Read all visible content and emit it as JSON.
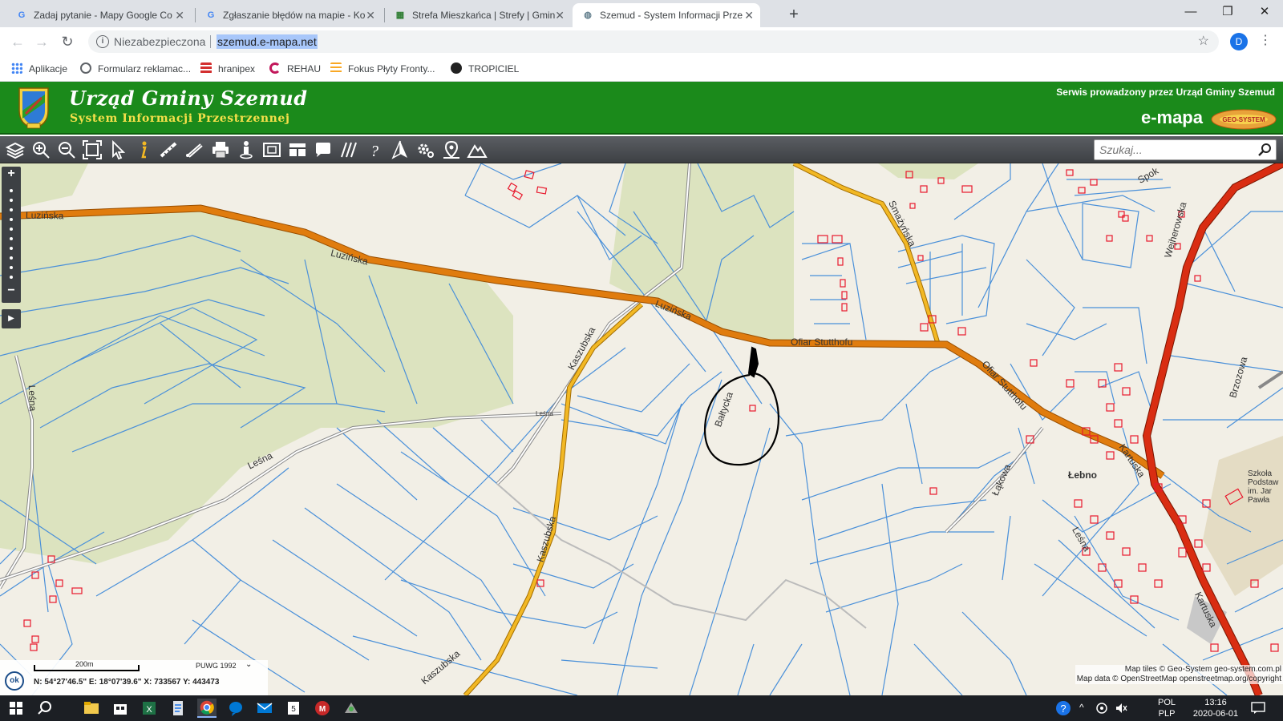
{
  "browser": {
    "tabs": [
      {
        "title": "Zadaj pytanie - Mapy Google Co",
        "favicon": "google-icon",
        "active": false
      },
      {
        "title": "Zgłaszanie błędów na mapie - Ko",
        "favicon": "google-icon",
        "active": false
      },
      {
        "title": "Strefa Mieszkańca | Strefy | Gmin",
        "favicon": "map-icon",
        "active": false
      },
      {
        "title": "Szemud - System Informacji Prze",
        "favicon": "globe-icon",
        "active": true
      }
    ],
    "new_tab": "+",
    "window_buttons": {
      "minimize": "—",
      "maximize": "❐",
      "close": "✕"
    },
    "security_label": "Niezabezpieczona",
    "url": "szemud.e-mapa.net",
    "profile_initial": "D",
    "bookmarks": [
      {
        "label": "Aplikacje",
        "icon": "apps-grid-icon",
        "color": "#4285f4"
      },
      {
        "label": "Formularz reklamac...",
        "icon": "globe-icon",
        "color": "#5f6368"
      },
      {
        "label": "hranipex",
        "icon": "hranipex-icon",
        "color": "#d32f2f"
      },
      {
        "label": "REHAU",
        "icon": "rehau-icon",
        "color": "#c2185b"
      },
      {
        "label": "Fokus Płyty Fronty...",
        "icon": "fokus-icon",
        "color": "#f9a825"
      },
      {
        "label": "TROPICIEL",
        "icon": "tropiciel-icon",
        "color": "#222222"
      }
    ]
  },
  "site": {
    "title": "Urząd Gminy Szemud",
    "subtitle": "System Informacji Przestrzennej",
    "service_text": "Serwis prowadzony przez Urząd Gminy Szemud",
    "brand": "e-mapa",
    "partner_logo_text": "GEO-SYSTEM",
    "header_color": "#1b8a1b"
  },
  "map_toolbar": {
    "tools": [
      "layers-icon",
      "zoom-in-icon",
      "zoom-out-icon",
      "zoom-extent-icon",
      "pointer-icon",
      "info-icon",
      "measure-distance-icon",
      "measure-area-icon",
      "print-icon",
      "street-view-icon",
      "overview-icon",
      "table-icon",
      "comment-icon",
      "hatch-icon",
      "help-icon",
      "north-arrow-icon",
      "settings-icon",
      "location-icon",
      "terrain-icon"
    ],
    "search_placeholder": "Szukaj..."
  },
  "map": {
    "zoom_in": "+",
    "zoom_out": "−",
    "expand_panel": "▶",
    "street_labels": [
      {
        "text": "Luzińska"
      },
      {
        "text": "Luzińska"
      },
      {
        "text": "Luzińska"
      },
      {
        "text": "Ofiar Stutthofu"
      },
      {
        "text": "Ofiar Stutthofu"
      },
      {
        "text": "Kaszubska"
      },
      {
        "text": "Kaszubska"
      },
      {
        "text": "Kaszubska"
      },
      {
        "text": "Leśna"
      },
      {
        "text": "Leśna"
      },
      {
        "text": "Leśna"
      },
      {
        "text": "Bałtycka"
      },
      {
        "text": "Smażyńska"
      },
      {
        "text": "Wejherowska"
      },
      {
        "text": "Kartuska"
      },
      {
        "text": "Kartuska"
      },
      {
        "text": "Łąkowa"
      },
      {
        "text": "Brzozowa"
      },
      {
        "text": "Leśna"
      },
      {
        "text": "Spok"
      }
    ],
    "place_label": "Łebno",
    "school_label": [
      "Szkoła",
      "Podstaw",
      "im. Jar",
      "Pawła"
    ],
    "scale_label": "200m",
    "crs": "PUWG 1992",
    "ok_button": "ok",
    "coordinates": "N: 54°27'46.5\"  E: 18°07'39.6\"  X: 733567    Y: 443473",
    "attribution_1": "Map tiles © Geo-System geo-system.com.pl",
    "attribution_2": "Map data © OpenStreetMap openstreetmap.org/copyright",
    "colors": {
      "main_road": "#e07c0e",
      "secondary_road": "#f2b824",
      "regional_road": "#d92d12",
      "parcel": "#4a90d9",
      "building": "#e8182c",
      "forest": "#dce3bf"
    }
  },
  "taskbar": {
    "language": [
      "POL",
      "PLP"
    ],
    "time": "13:16",
    "date": "2020-06-01"
  }
}
